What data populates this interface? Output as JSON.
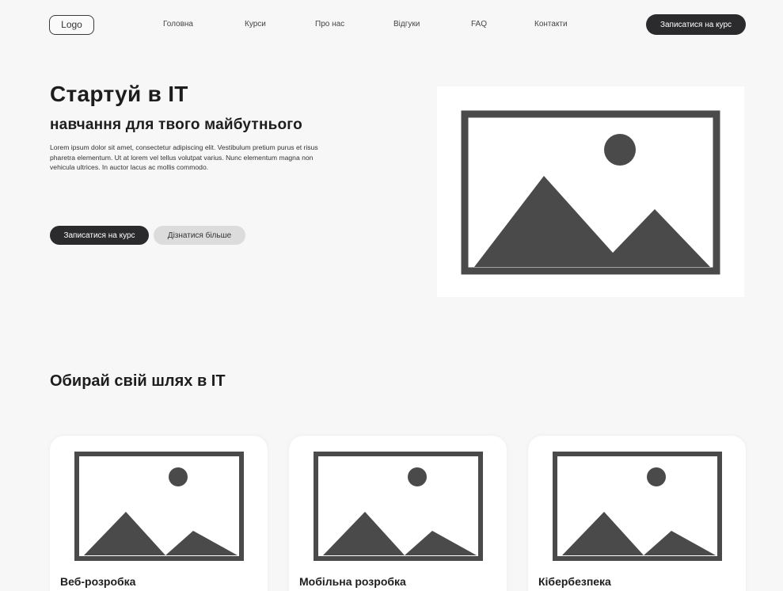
{
  "header": {
    "logo": "Logo",
    "nav": [
      "Головна",
      "Курси",
      "Про нас",
      "Відгуки",
      "FAQ",
      "Контакти"
    ],
    "cta_label": "Записатися на курс"
  },
  "hero": {
    "title": "Стартуй в IT",
    "subtitle": "навчання для твого майбутнього",
    "text": "Lorem ipsum dolor sit amet, consectetur adipiscing elit. Vestibulum pretium purus et risus pharetra elementum. Ut at lorem vel tellus volutpat varius. Nunc elementum magna non vehicula ultrices. In auctor lacus ac mollis commodo.",
    "primary_button": "Записатися на курс",
    "secondary_button": "Дізнатися більше",
    "image_icon": "image-placeholder-icon"
  },
  "courses": {
    "title": "Обирай свій шлях в IT",
    "cards": [
      {
        "title": "Веб-розробка",
        "image_icon": "image-placeholder-icon"
      },
      {
        "title": "Мобільна розробка",
        "image_icon": "image-placeholder-icon"
      },
      {
        "title": "Кібербезпека",
        "image_icon": "image-placeholder-icon"
      }
    ]
  },
  "colors": {
    "background": "#f7f7f7",
    "dark_button": "#2b2b2d",
    "light_button": "#dcdcdc",
    "placeholder_gray": "#4a4a4a"
  }
}
